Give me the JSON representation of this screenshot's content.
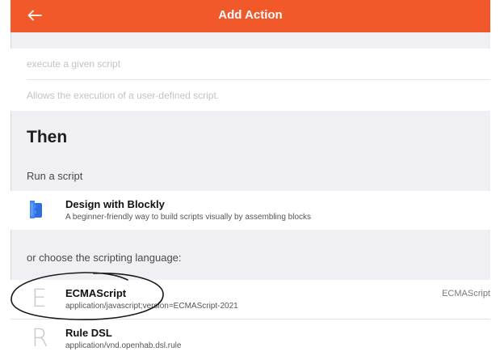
{
  "navbar": {
    "back_icon": "arrow-left-icon",
    "title": "Add Action",
    "color": "#f1592a"
  },
  "fields": {
    "label_placeholder": "execute a given script",
    "description_placeholder": "Allows the execution of a user-defined script."
  },
  "block": {
    "title": "Then",
    "run_label": "Run a script",
    "blockly": {
      "icon": "blockly-puzzle-icon",
      "title": "Design with Blockly",
      "subtitle": "A beginner-friendly way to build scripts visually by assembling blocks"
    },
    "choose_label": "or choose the scripting language:",
    "languages": [
      {
        "letter": "E",
        "title": "ECMAScript",
        "subtitle": "application/javascript;version=ECMAScript-2021",
        "after": "ECMAScript"
      },
      {
        "letter": "R",
        "title": "Rule DSL",
        "subtitle": "application/vnd.openhab.dsl.rule",
        "after": ""
      }
    ]
  },
  "annotation": {
    "type": "hand-drawn-circle",
    "color": "#1a1a1a"
  }
}
